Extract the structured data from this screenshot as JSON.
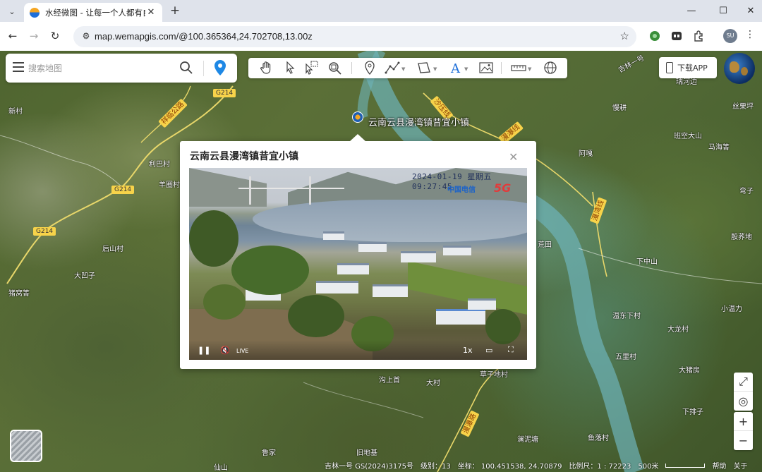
{
  "browser": {
    "tab_title": "水经微图 - 让每一个人都有自己",
    "url": "map.wemapgis.com/@100.365364,24.702708,13.00z",
    "profile_initials": "SU"
  },
  "search": {
    "placeholder": "搜索地图"
  },
  "download_app": "下载APP",
  "marker": {
    "label": "云南云县漫湾镇昔宜小镇"
  },
  "popup": {
    "title": "云南云县漫湾镇昔宜小镇",
    "timestamp": "2024-01-19  星期五  09:27:45",
    "brand": "中国电信",
    "network": "5G",
    "live_label": "LIVE",
    "speed": "1x"
  },
  "places": [
    {
      "name": "新村",
      "key": "xincun"
    },
    {
      "name": "利巴村",
      "key": "libacun"
    },
    {
      "name": "羊圈村",
      "key": "yangjuancun"
    },
    {
      "name": "后山村",
      "key": "houshancun"
    },
    {
      "name": "大凹子",
      "key": "daaozi"
    },
    {
      "name": "猪窝箐",
      "key": "zhuwoqing"
    },
    {
      "name": "吉林一号",
      "key": "jilin"
    },
    {
      "name": "瑞河边",
      "key": "ruihebian"
    },
    {
      "name": "慢耕",
      "key": "mangeng"
    },
    {
      "name": "丝栗坪",
      "key": "silitping"
    },
    {
      "name": "班空大山",
      "key": "bankongdashan"
    },
    {
      "name": "马海箐",
      "key": "mahaiqing"
    },
    {
      "name": "阿嘎",
      "key": "aga"
    },
    {
      "name": "弯子",
      "key": "wanzi"
    },
    {
      "name": "荒田",
      "key": "huangtian"
    },
    {
      "name": "殷荞地",
      "key": "yinqiaodi"
    },
    {
      "name": "下中山",
      "key": "xiazhongshan"
    },
    {
      "name": "温东下村",
      "key": "wendongxiacun"
    },
    {
      "name": "小温力",
      "key": "xiaowenli"
    },
    {
      "name": "大龙村",
      "key": "dalongcun"
    },
    {
      "name": "五里村",
      "key": "wulicun"
    },
    {
      "name": "大猪房",
      "key": "dazhufang"
    },
    {
      "name": "草子地村",
      "key": "caozidicun"
    },
    {
      "name": "沟上首",
      "key": "goushangshou"
    },
    {
      "name": "大村",
      "key": "dacun"
    },
    {
      "name": "下排子",
      "key": "xiapaizi"
    },
    {
      "name": "鱼落村",
      "key": "yuluocun"
    },
    {
      "name": "澜泥塘",
      "key": "lannitang"
    },
    {
      "name": "鲁家",
      "key": "lujia"
    },
    {
      "name": "旧地基",
      "key": "jiudiji"
    },
    {
      "name": "仙山",
      "key": "xianshan"
    }
  ],
  "roads": {
    "g214": "G214",
    "xiangling": "祥临公路",
    "shaya": "沙压线",
    "manwan": "漫湾线",
    "manye": "漫瀑线",
    "mankun": "漫瀑路"
  },
  "status": {
    "source": "吉林一号 GS(2024)3175号",
    "level_label": "级别：",
    "level": "13",
    "coord_label": "坐标：",
    "lon": "100.451538,",
    "lat": "24.70879",
    "scale_label": "比例尺：1 : 72223",
    "scale_bar": "500米",
    "help": "帮助",
    "about": "关于"
  }
}
